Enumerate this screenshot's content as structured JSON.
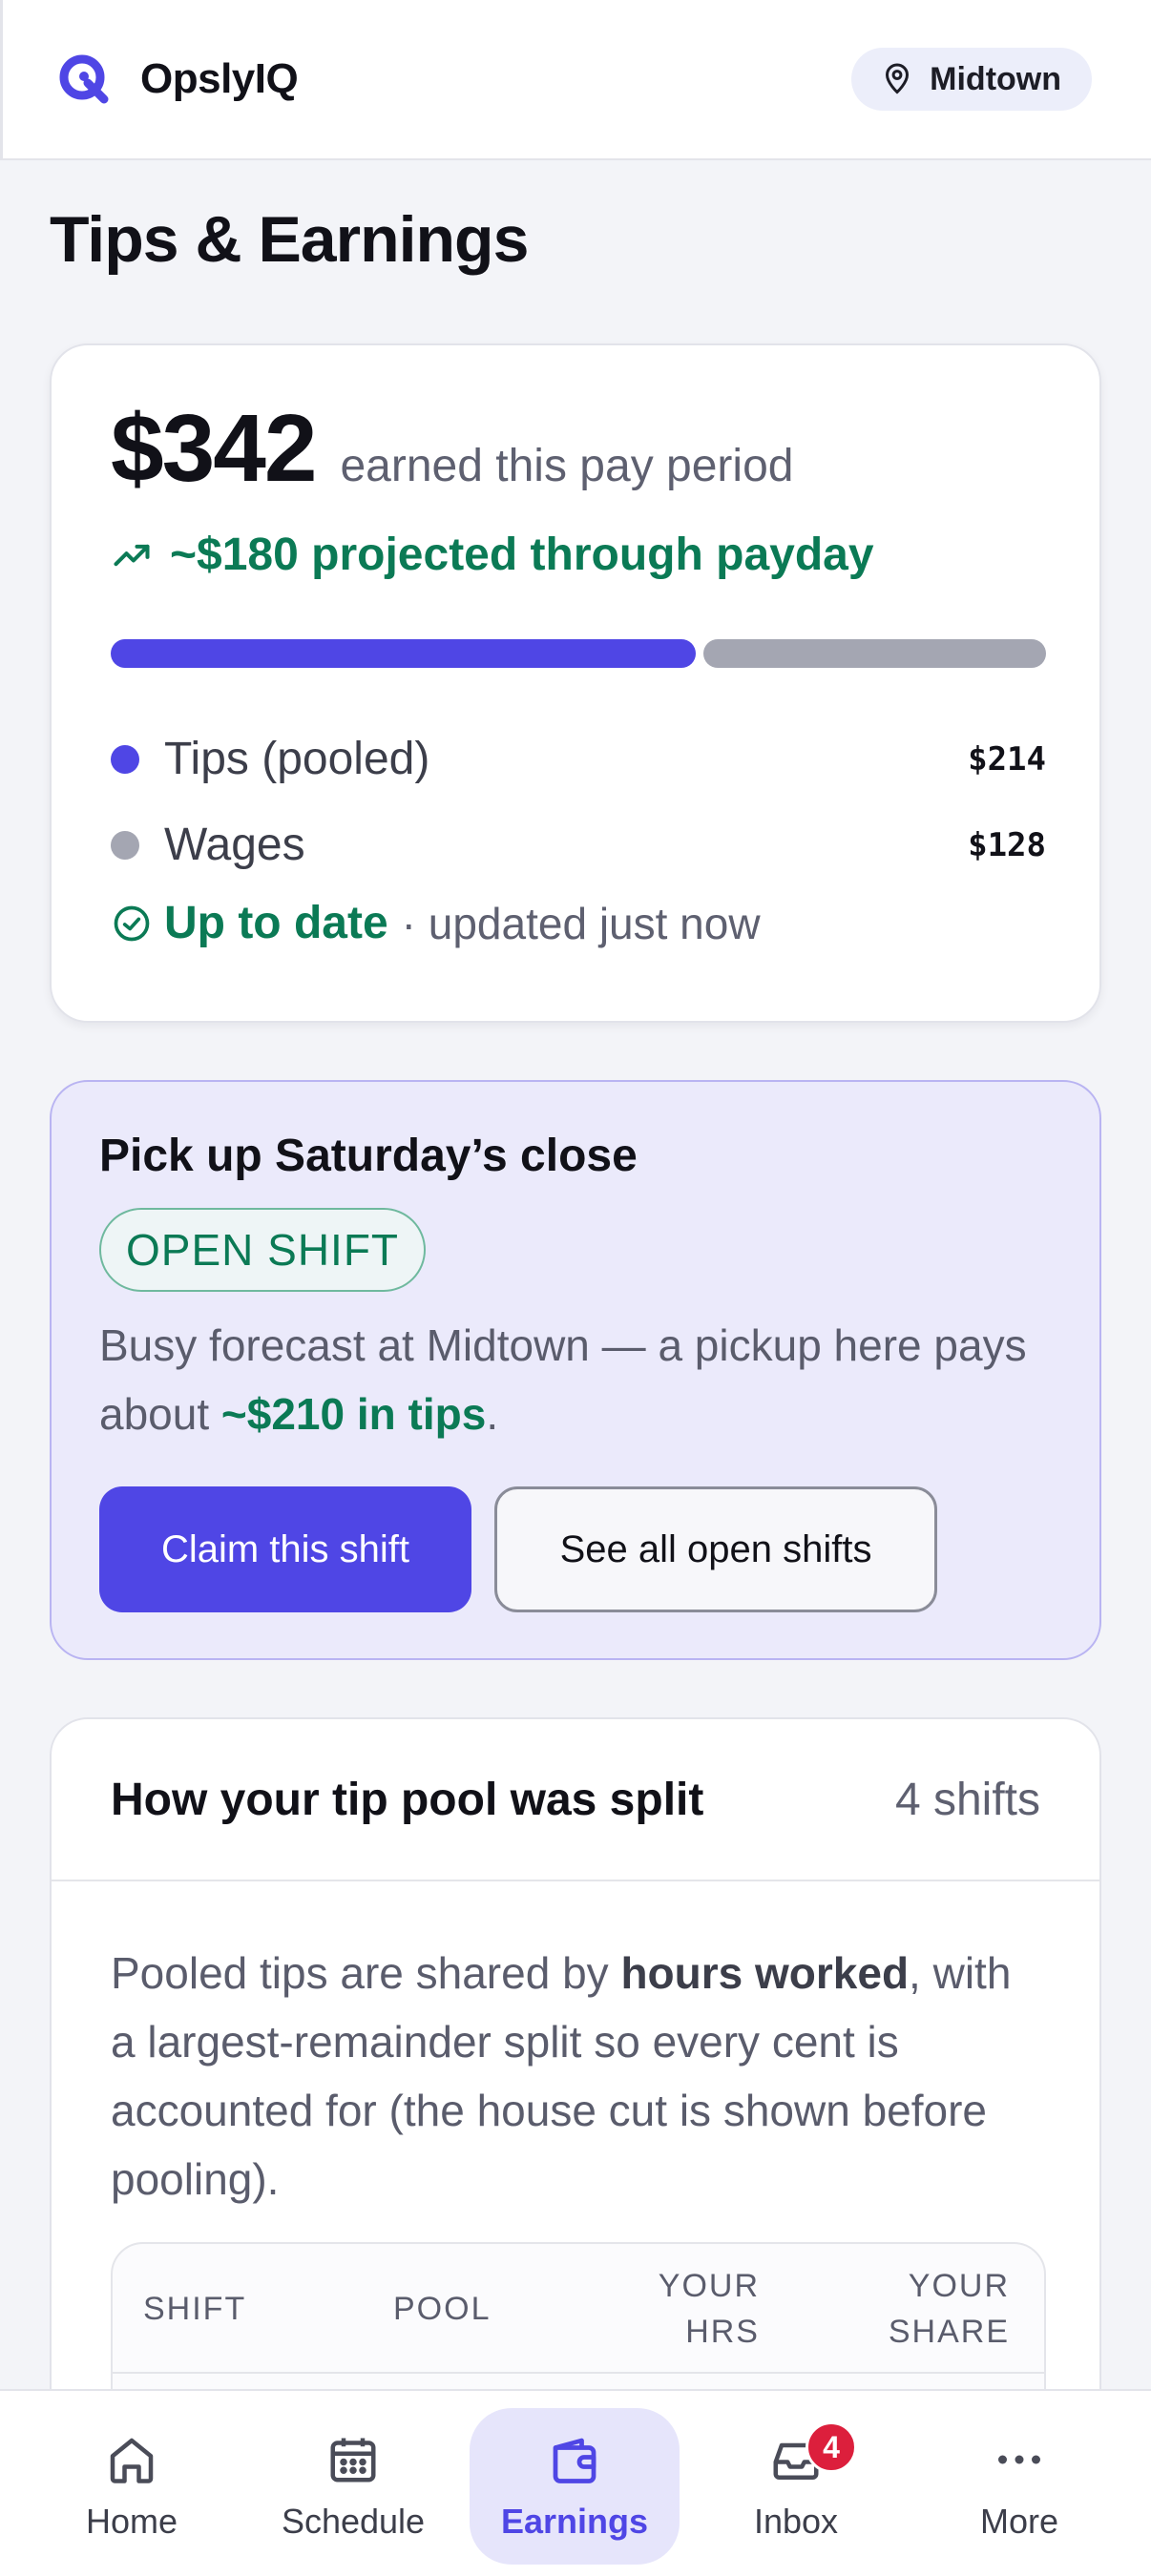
{
  "app": {
    "name": "OpslyIQ",
    "location": "Midtown"
  },
  "page": {
    "title": "Tips & Earnings"
  },
  "earnings": {
    "amount": "$342",
    "subtitle": "earned this pay period",
    "projection": "~$180 projected through payday",
    "tips_fraction": 0.626,
    "breakdown": [
      {
        "label": "Tips (pooled)",
        "value": "$214",
        "color": "#4f46e5"
      },
      {
        "label": "Wages",
        "value": "$128",
        "color": "#a4a6b2"
      }
    ],
    "status": "Up to date",
    "status_detail": "· updated just now"
  },
  "pickup": {
    "title": "Pick up Saturday’s close",
    "badge": "OPEN SHIFT",
    "body_prefix": "Busy forecast at Midtown — a pickup here pays about ",
    "body_highlight": "~$210 in tips",
    "body_suffix": ".",
    "primary_button": "Claim this shift",
    "secondary_button": "See all open shifts"
  },
  "tip_pool": {
    "title": "How your tip pool was split",
    "count": "4 shifts",
    "desc_prefix": "Pooled tips are shared by ",
    "desc_bold": "hours worked",
    "desc_suffix": ", with a largest-remainder split so every cent is accounted for (the house cut is shown before pooling).",
    "columns": [
      "SHIFT",
      "POOL",
      "YOUR HRS",
      "YOUR SHARE"
    ]
  },
  "nav": {
    "items": [
      {
        "label": "Home",
        "icon": "home-icon"
      },
      {
        "label": "Schedule",
        "icon": "calendar-icon"
      },
      {
        "label": "Earnings",
        "icon": "wallet-icon",
        "active": true
      },
      {
        "label": "Inbox",
        "icon": "inbox-icon",
        "badge": "4"
      },
      {
        "label": "More",
        "icon": "more-icon"
      }
    ]
  },
  "colors": {
    "accent": "#4f46e5",
    "success": "#0b7a55",
    "badge": "#dc1f3c"
  }
}
